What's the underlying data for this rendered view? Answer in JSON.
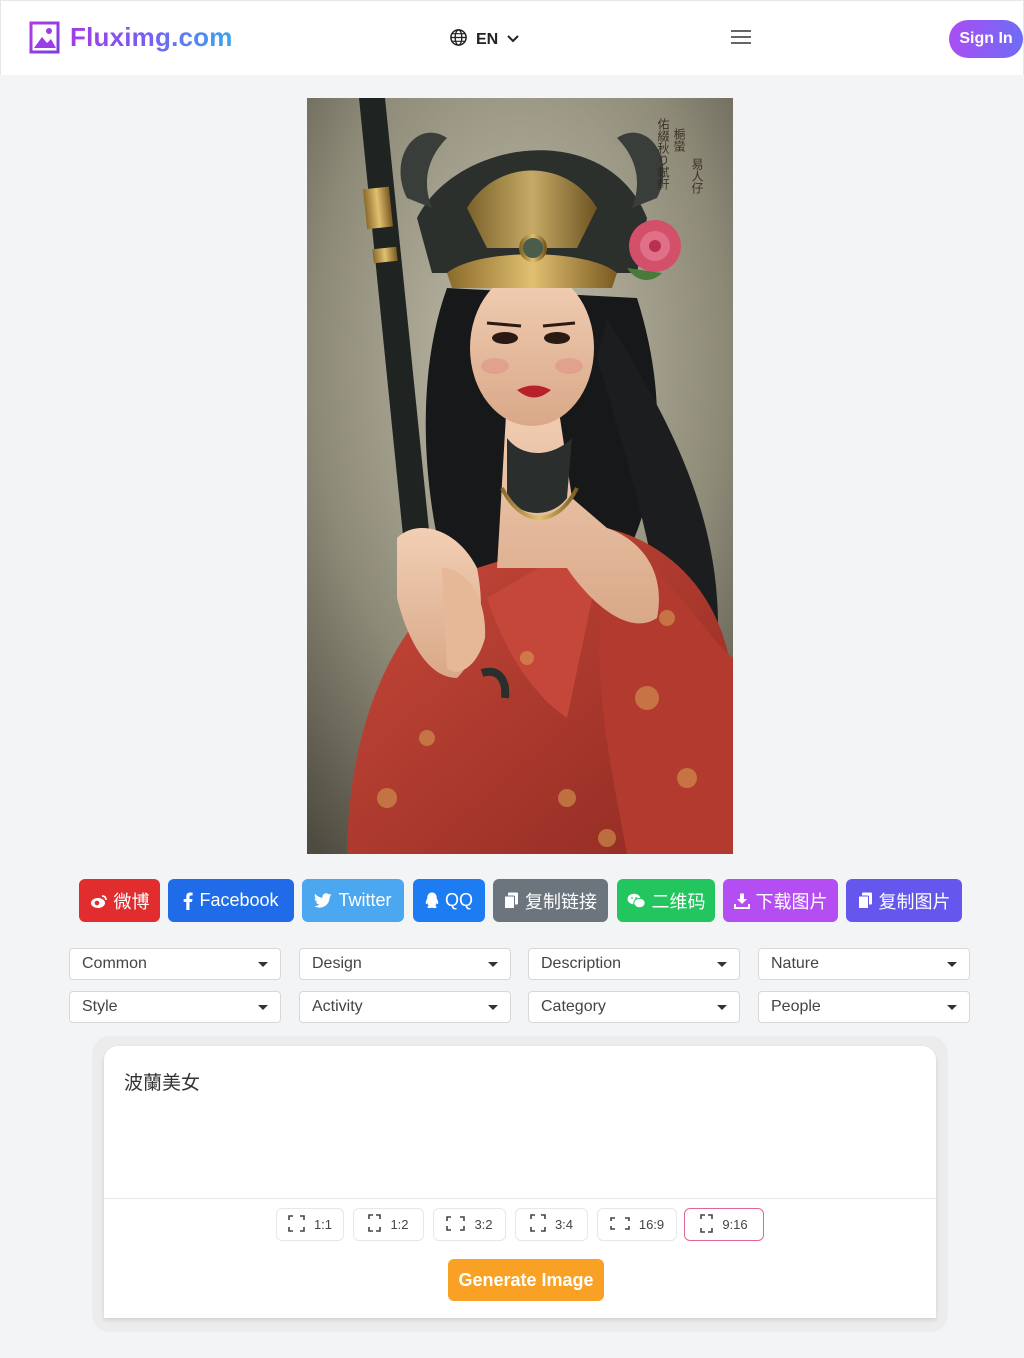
{
  "header": {
    "logo_text": "Fluximg.com",
    "language": "EN",
    "signin_label": "Sign In"
  },
  "share": {
    "weibo": "微博",
    "facebook": "Facebook",
    "twitter": "Twitter",
    "qq": "QQ",
    "copy_link": "复制链接",
    "qrcode": "二维码",
    "download": "下载图片",
    "copy_image": "复制图片"
  },
  "filters": [
    "Common",
    "Design",
    "Description",
    "Nature",
    "Style",
    "Activity",
    "Category",
    "People"
  ],
  "prompt": {
    "value": "波蘭美女"
  },
  "ratios": [
    "1:1",
    "1:2",
    "3:2",
    "3:4",
    "16:9",
    "9:16"
  ],
  "selected_ratio": "9:16",
  "generate_label": "Generate Image",
  "colors": {
    "weibo": "#e12d2d",
    "facebook": "#1f6be8",
    "twitter": "#4ba7ef",
    "qq": "#1e7cf2",
    "copy_link": "#6c757d",
    "qrcode": "#22c55e",
    "download": "#b44ef2",
    "copy_image": "#6556ee",
    "generate": "#f8a125"
  },
  "hero": {
    "alt": "portrait painting of a woman in red robe with ornate headdress holding a staff",
    "calligraphy": "梔蠻 易人仔 佑綴秋り軾軒"
  }
}
